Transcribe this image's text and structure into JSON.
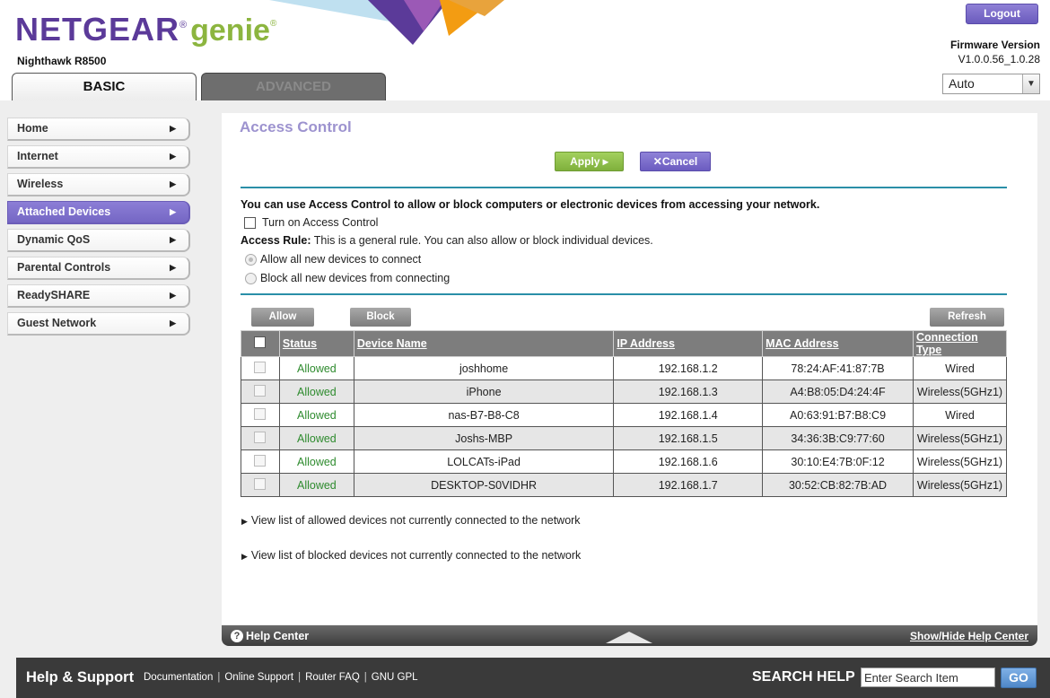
{
  "header": {
    "brand": "NETGEAR",
    "brand_mark": "®",
    "product": "genie",
    "product_mark": "®",
    "model": "Nighthawk R8500",
    "logout_label": "Logout",
    "firmware_label": "Firmware Version",
    "firmware_value": "V1.0.0.56_1.0.28",
    "language_value": "Auto",
    "tabs": [
      {
        "label": "BASIC",
        "active": true
      },
      {
        "label": "ADVANCED",
        "active": false
      }
    ]
  },
  "sidebar": {
    "items": [
      {
        "label": "Home"
      },
      {
        "label": "Internet"
      },
      {
        "label": "Wireless"
      },
      {
        "label": "Attached Devices",
        "active": true
      },
      {
        "label": "Dynamic QoS"
      },
      {
        "label": "Parental Controls"
      },
      {
        "label": "ReadySHARE"
      },
      {
        "label": "Guest Network"
      }
    ],
    "accent_color": "#7566c4"
  },
  "main": {
    "title": "Access Control",
    "apply_label": "Apply ▸",
    "cancel_label": "Cancel",
    "intro": "You can use Access Control to allow or block computers or electronic devices from accessing your network.",
    "toggle_label": "Turn on Access Control",
    "rule_heading": "Access Rule:",
    "rule_text": " This is a general rule. You can also allow or block individual devices.",
    "radio_options": [
      {
        "label": "Allow all new devices to connect",
        "checked": true
      },
      {
        "label": "Block all new devices from connecting",
        "checked": false
      }
    ],
    "allow_label": "Allow",
    "block_label": "Block",
    "refresh_label": "Refresh",
    "table": {
      "headers": [
        "Status",
        "Device Name",
        "IP Address",
        "MAC Address",
        "Connection Type"
      ],
      "rows": [
        {
          "status": "Allowed",
          "name": "joshhome",
          "ip": "192.168.1.2",
          "mac": "78:24:AF:41:87:7B",
          "conn": "Wired"
        },
        {
          "status": "Allowed",
          "name": "iPhone",
          "ip": "192.168.1.3",
          "mac": "A4:B8:05:D4:24:4F",
          "conn": "Wireless(5GHz1)"
        },
        {
          "status": "Allowed",
          "name": "nas-B7-B8-C8",
          "ip": "192.168.1.4",
          "mac": "A0:63:91:B7:B8:C9",
          "conn": "Wired"
        },
        {
          "status": "Allowed",
          "name": "Joshs-MBP",
          "ip": "192.168.1.5",
          "mac": "34:36:3B:C9:77:60",
          "conn": "Wireless(5GHz1)"
        },
        {
          "status": "Allowed",
          "name": "LOLCATs-iPad",
          "ip": "192.168.1.6",
          "mac": "30:10:E4:7B:0F:12",
          "conn": "Wireless(5GHz1)"
        },
        {
          "status": "Allowed",
          "name": "DESKTOP-S0VIDHR",
          "ip": "192.168.1.7",
          "mac": "30:52:CB:82:7B:AD",
          "conn": "Wireless(5GHz1)"
        }
      ]
    },
    "expanders": [
      "View list of allowed devices not currently connected to the network",
      "View list of blocked devices not currently connected to the network"
    ],
    "status_color": "#2e8b2e"
  },
  "helpbar": {
    "label": "Help Center",
    "toggle_label": "Show/Hide Help Center",
    "icon": "question-icon"
  },
  "footer": {
    "title": "Help & Support",
    "links": [
      "Documentation",
      "Online Support",
      "Router FAQ",
      "GNU GPL"
    ],
    "search_label": "SEARCH HELP",
    "search_value": "Enter Search Item",
    "go_label": "GO"
  }
}
